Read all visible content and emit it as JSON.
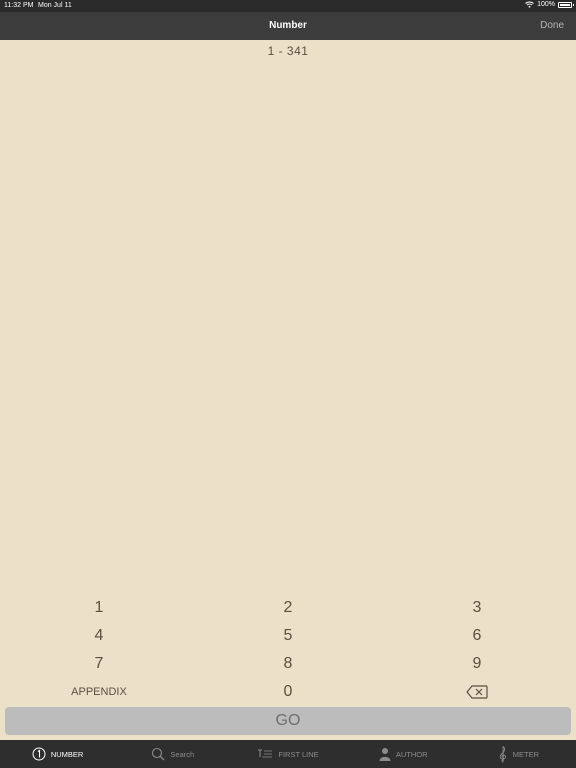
{
  "status_bar": {
    "time": "11:32 PM",
    "date": "Mon Jul 11",
    "battery": "100%"
  },
  "nav": {
    "title": "Number",
    "done_label": "Done"
  },
  "range_text": "1 - 341",
  "keypad": {
    "rows": [
      [
        "1",
        "2",
        "3"
      ],
      [
        "4",
        "5",
        "6"
      ],
      [
        "7",
        "8",
        "9"
      ]
    ],
    "appendix_label": "APPENDIX",
    "zero_label": "0"
  },
  "go_label": "GO",
  "tabs": [
    {
      "label": "NUMBER",
      "icon": "number-circle-icon",
      "active": true
    },
    {
      "label": "Search",
      "icon": "search-icon",
      "active": false
    },
    {
      "label": "FIRST LINE",
      "icon": "first-line-icon",
      "active": false
    },
    {
      "label": "AUTHOR",
      "icon": "person-icon",
      "active": false
    },
    {
      "label": "METER",
      "icon": "treble-clef-icon",
      "active": false
    }
  ],
  "colors": {
    "background": "#ebe1c8",
    "nav_bar": "#3c3c3c",
    "tab_bar": "#2e2e2e",
    "go_button": "#bdbcbc",
    "key_text": "#5a5040"
  }
}
